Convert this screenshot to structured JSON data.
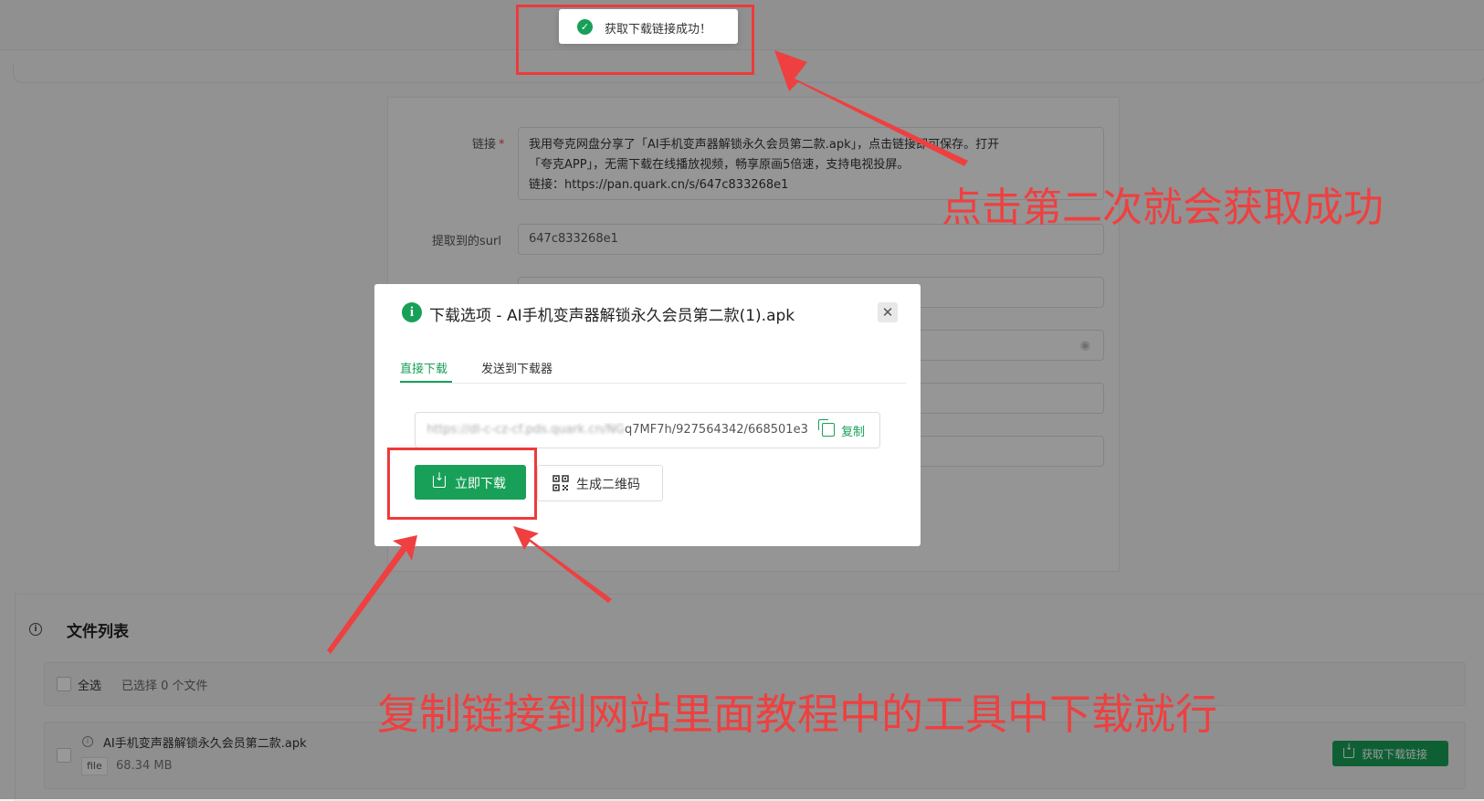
{
  "toast": {
    "message": "获取下载链接成功！",
    "icon": "check-circle-icon"
  },
  "form": {
    "link_label": "链接",
    "required_mark": "*",
    "link_lines": [
      "我用夸克网盘分享了「AI手机变声器解锁永久会员第二款.apk」，点击链接即可保存。打开",
      "「夸克APP」，无需下载在线播放视频，畅享原画5倍速，支持电视投屏。",
      "链接：https://pan.quark.cn/s/647c833268e1"
    ],
    "surl_label": "提取到的surl",
    "surl_value": "647c833268e1"
  },
  "modal": {
    "title": "下载选项 - AI手机变声器解锁永久会员第二款(1).apk",
    "close_icon": "close-icon",
    "tabs": [
      {
        "label": "直接下载",
        "active": true
      },
      {
        "label": "发送到下载器",
        "active": false
      }
    ],
    "url_blurred": "https://dl-c-cz-cf.pds.quark.cn/NG",
    "url_visible": "q7MF7h/927564342/668501e3",
    "copy_label": "复制",
    "download_button": "立即下载",
    "qr_button": "生成二维码"
  },
  "file_list": {
    "title": "文件列表",
    "select_all": "全选",
    "selected_count": "已选择 0 个文件",
    "files": [
      {
        "name": "AI手机变声器解锁永久会员第二款.apk",
        "type_tag": "file",
        "size": "68.34 MB",
        "action": "获取下载链接"
      }
    ]
  },
  "annotations": {
    "text_1": "点击第二次就会获取成功",
    "text_2": "复制链接到网站里面教程中的工具中下载就行"
  },
  "colors": {
    "accent_green": "#18a058",
    "annotation_red": "#ee3a3a"
  }
}
